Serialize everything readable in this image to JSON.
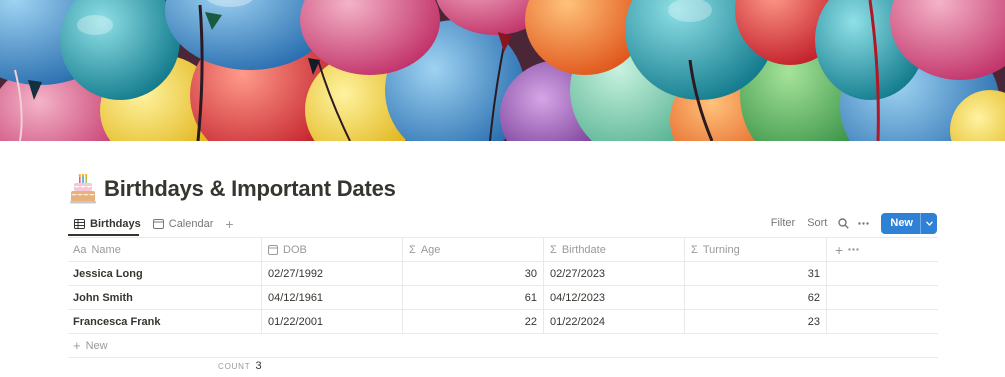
{
  "page": {
    "title": "Birthdays & Important Dates",
    "icon": "birthday-cake-icon"
  },
  "views": {
    "tabs": [
      {
        "label": "Birthdays",
        "icon": "table-icon",
        "active": true
      },
      {
        "label": "Calendar",
        "icon": "calendar-icon",
        "active": false
      }
    ],
    "add_view_icon": "plus-icon"
  },
  "toolbar": {
    "filter_label": "Filter",
    "sort_label": "Sort",
    "search_icon": "search-icon",
    "more_icon": "more-horizontal-icon",
    "new_label": "New",
    "new_color": "#2f81d6"
  },
  "table": {
    "columns": [
      {
        "label": "Name",
        "type_icon": "Aa"
      },
      {
        "label": "DOB",
        "type_icon": "calendar-icon"
      },
      {
        "label": "Age",
        "type_icon": "Σ"
      },
      {
        "label": "Birthdate",
        "type_icon": "Σ"
      },
      {
        "label": "Turning",
        "type_icon": "Σ"
      }
    ],
    "rows": [
      {
        "name": "Jessica Long",
        "dob": "02/27/1992",
        "age": "30",
        "birthdate": "02/27/2023",
        "turning": "31"
      },
      {
        "name": "John Smith",
        "dob": "04/12/1961",
        "age": "61",
        "birthdate": "04/12/2023",
        "turning": "62"
      },
      {
        "name": "Francesca Frank",
        "dob": "01/22/2001",
        "age": "22",
        "birthdate": "01/22/2024",
        "turning": "23"
      }
    ],
    "new_row_label": "New",
    "count_label": "COUNT",
    "count_value": "3"
  },
  "colors": {
    "text": "#37352f",
    "muted": "#9b9a97",
    "border": "#e9e9e7",
    "accent": "#2f81d6"
  }
}
